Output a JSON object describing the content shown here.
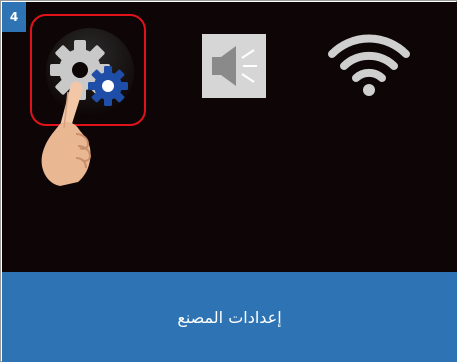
{
  "step": {
    "number": "4"
  },
  "screen": {
    "icons": [
      {
        "name": "settings-icon",
        "highlighted": true
      },
      {
        "name": "speaker-icon"
      },
      {
        "name": "wifi-icon"
      }
    ],
    "pointer": "hand-pointer-icon"
  },
  "caption": {
    "text": "إعدادات المصنع"
  },
  "colors": {
    "accent": "#2e74b5",
    "highlight": "#e0131b",
    "screen_bg": "#0e0606",
    "gear_blue": "#1f4ea8"
  }
}
